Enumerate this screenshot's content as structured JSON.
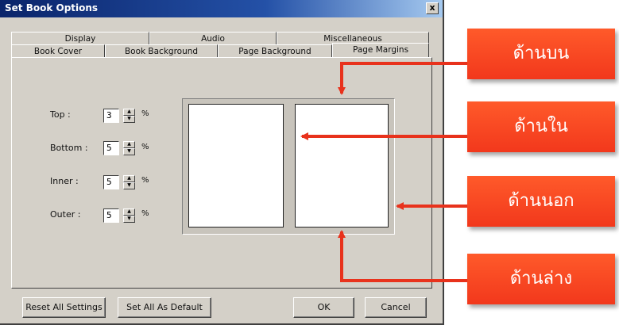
{
  "window": {
    "title": "Set Book Options",
    "close_label": "x"
  },
  "tabs": {
    "row_back": [
      "Display",
      "Audio",
      "Miscellaneous"
    ],
    "row_front": [
      "Book Cover",
      "Book Background",
      "Page Background",
      "Page Margins"
    ],
    "active": "Page Margins"
  },
  "fields": [
    {
      "label": "Top :",
      "value": "3",
      "unit": "%"
    },
    {
      "label": "Bottom :",
      "value": "5",
      "unit": "%"
    },
    {
      "label": "Inner :",
      "value": "5",
      "unit": "%"
    },
    {
      "label": "Outer :",
      "value": "5",
      "unit": "%"
    }
  ],
  "buttons": {
    "reset": "Reset All Settings",
    "set_default": "Set All As Default",
    "ok": "OK",
    "cancel": "Cancel"
  },
  "callouts": {
    "top": "ด้านบน",
    "inner": "ด้านใน",
    "outer": "ด้านนอก",
    "bottom": "ด้านล่าง"
  },
  "colors": {
    "callout_red": "#f2381c",
    "titlebar": "#0a246a",
    "dialog_face": "#d4d0c8"
  }
}
